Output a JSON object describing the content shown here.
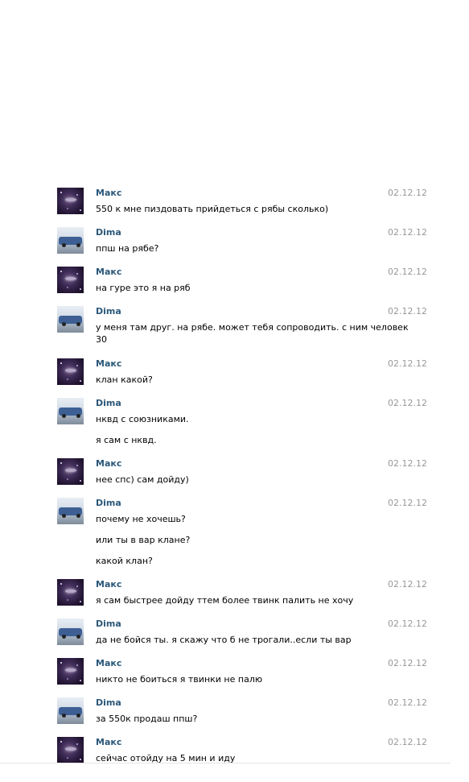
{
  "messages": [
    {
      "author": "Макс",
      "avatar": "maks",
      "date": "02.12.12",
      "lines": [
        "550 к мне пиздовать прийдеться с рябы сколько)"
      ]
    },
    {
      "author": "Dima",
      "avatar": "dima",
      "date": "02.12.12",
      "lines": [
        "ппш на рябе?"
      ]
    },
    {
      "author": "Макс",
      "avatar": "maks",
      "date": "02.12.12",
      "lines": [
        "на гуре это я на ряб"
      ]
    },
    {
      "author": "Dima",
      "avatar": "dima",
      "date": "02.12.12",
      "lines": [
        "у меня там друг. на рябе. может тебя сопроводить. с ним человек",
        "30"
      ]
    },
    {
      "author": "Макс",
      "avatar": "maks",
      "date": "02.12.12",
      "lines": [
        "клан какой?"
      ]
    },
    {
      "author": "Dima",
      "avatar": "dima",
      "date": "02.12.12",
      "lines": [
        "нквд с союзниками.",
        "я сам с нквд."
      ]
    },
    {
      "author": "Макс",
      "avatar": "maks",
      "date": "02.12.12",
      "lines": [
        "нее спс) сам дойду)"
      ]
    },
    {
      "author": "Dima",
      "avatar": "dima",
      "date": "02.12.12",
      "lines": [
        "почему не хочешь?",
        "или ты в вар клане?",
        "какой клан?"
      ]
    },
    {
      "author": "Макс",
      "avatar": "maks",
      "date": "02.12.12",
      "lines": [
        "я сам быстрее дойду ттем более твинк палить не хочу"
      ]
    },
    {
      "author": "Dima",
      "avatar": "dima",
      "date": "02.12.12",
      "lines": [
        "да не бойся ты. я скажу что б не трогали..если ты вар"
      ]
    },
    {
      "author": "Макс",
      "avatar": "maks",
      "date": "02.12.12",
      "lines": [
        "никто не боиться я твинки не палю"
      ]
    },
    {
      "author": "Dima",
      "avatar": "dima",
      "date": "02.12.12",
      "lines": [
        "за 550к продаш ппш?"
      ]
    },
    {
      "author": "Макс",
      "avatar": "maks",
      "date": "02.12.12",
      "lines": [
        "сейчас отойду на 5 мин и иду"
      ]
    }
  ]
}
